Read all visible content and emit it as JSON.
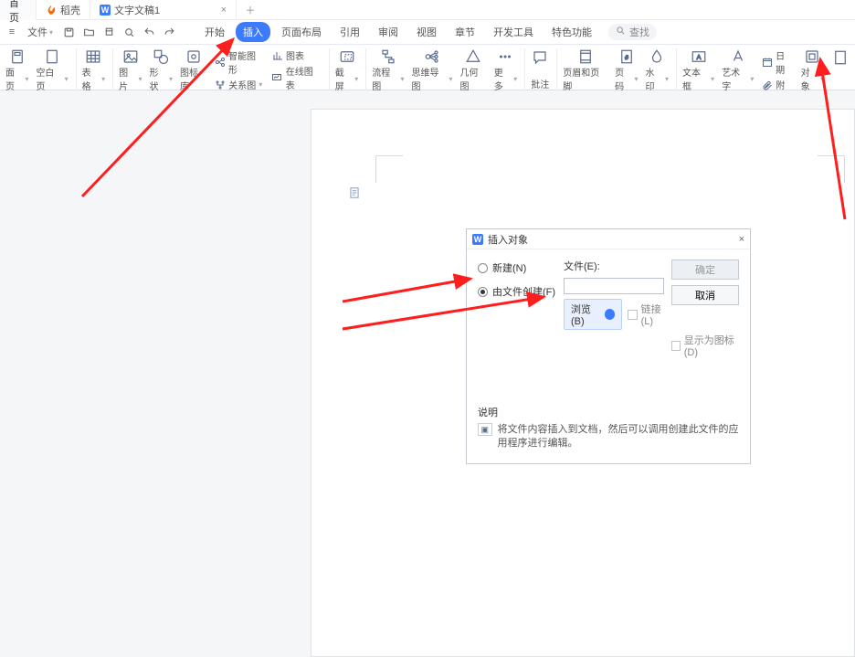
{
  "tabs": {
    "home": "首页",
    "daoke_icon": "W",
    "daoke": "稻壳",
    "doc_icon": "W",
    "doc": "文字文稿1"
  },
  "menubar": {
    "file": "文件",
    "search_placeholder": "查找",
    "tabs": [
      "开始",
      "插入",
      "页面布局",
      "引用",
      "审阅",
      "视图",
      "章节",
      "开发工具",
      "特色功能"
    ]
  },
  "ribbon": {
    "cover": "面页",
    "blank": "空白页",
    "table": "表格",
    "image": "图片",
    "shape": "形状",
    "iconlib": "图标库",
    "smart_shape": "智能图形",
    "chart": "图表",
    "relation": "关系图",
    "online_chart": "在线图表",
    "screenshot": "截屏",
    "flowchart": "流程图",
    "mindmap": "思维导图",
    "geometry": "几何图",
    "more": "更多",
    "comment": "批注",
    "headerfooter": "页眉和页脚",
    "pagenum": "页码",
    "watermark": "水印",
    "textbox": "文本框",
    "wordart": "艺术字",
    "date": "日期",
    "object": "对象"
  },
  "dialog": {
    "title": "插入对象",
    "opt_new": "新建(N)",
    "opt_file": "由文件创建(F)",
    "file_label": "文件(E):",
    "browse": "浏览(B)",
    "link": "链接(L)",
    "show_icon": "显示为图标(D)",
    "ok": "确定",
    "cancel": "取消",
    "explain_title": "说明",
    "explain_text": "将文件内容插入到文档，然后可以调用创建此文件的应用程序进行编辑。"
  }
}
